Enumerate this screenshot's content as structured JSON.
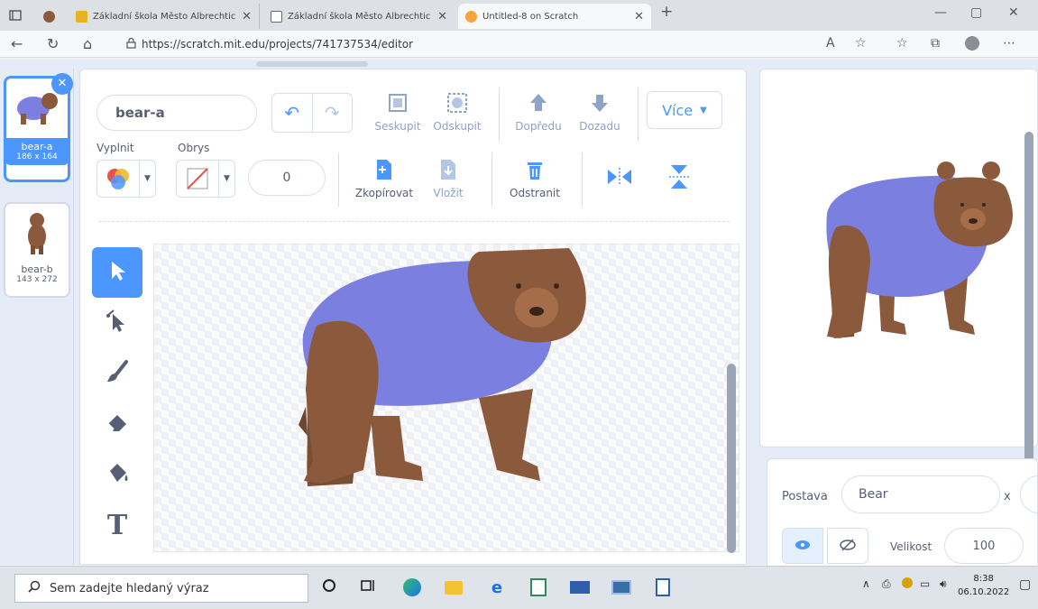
{
  "browser": {
    "tabs": [
      {
        "title": "",
        "favicon": "tab-actions-icon"
      },
      {
        "title": "",
        "favicon": "profile-icon"
      },
      {
        "title": "Základní škola Město Albrechtic",
        "favicon": "school-icon"
      },
      {
        "title": "Základní škola Město Albrechtic",
        "favicon": "school-icon"
      },
      {
        "title": "Untitled-8 on Scratch",
        "favicon": "scratch-icon"
      }
    ],
    "new_tab": "+",
    "window_controls": {
      "minimize": "—",
      "maximize": "▢",
      "close": "✕"
    },
    "url": "https://scratch.mit.edu/projects/741737534/editor",
    "reader_label": "A"
  },
  "costumes": [
    {
      "name": "bear-a",
      "size": "186 x 164",
      "selected": true,
      "delete": "✕"
    },
    {
      "name": "bear-b",
      "size": "143 x 272",
      "selected": false
    }
  ],
  "paint": {
    "costume_name": "bear-a",
    "undo": "↶",
    "redo": "↷",
    "group_label": "Seskupit",
    "ungroup_label": "Odskupit",
    "forward_label": "Dopředu",
    "backward_label": "Dozadu",
    "more_label": "Více",
    "fill_label": "Vyplnit",
    "outline_label": "Obrys",
    "outline_width": "0",
    "copy_label": "Zkopírovat",
    "paste_label": "Vložit",
    "delete_label": "Odstranit",
    "tool_text_glyph": "T",
    "colors": {
      "accent": "#4c97ff",
      "sweater": "#7b7fe0",
      "bear": "#8b5a3c"
    }
  },
  "sprite_info": {
    "sprite_label": "Postava",
    "sprite_name": "Bear",
    "x_label": "x",
    "size_label": "Velikost",
    "size_value": "100"
  },
  "taskbar": {
    "search_placeholder": "Sem zadejte hledaný výraz",
    "time": "8:38",
    "date": "06.10.2022"
  }
}
